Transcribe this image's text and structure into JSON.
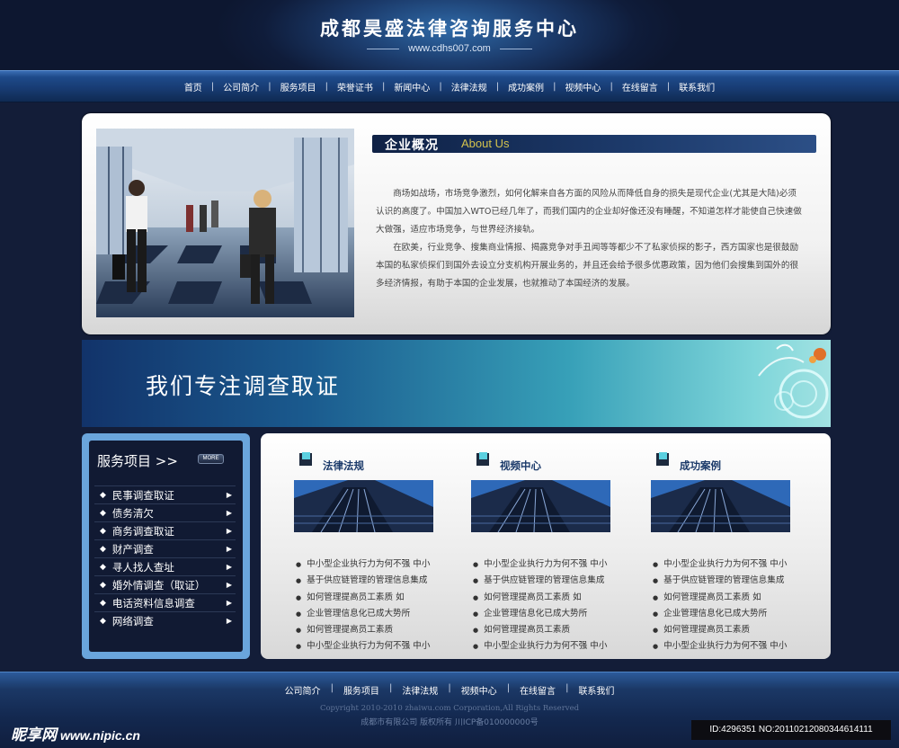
{
  "header": {
    "title": "成都昊盛法律咨询服务中心",
    "url": "www.cdhs007.com"
  },
  "nav": {
    "items": [
      "首页",
      "公司简介",
      "服务项目",
      "荣誉证书",
      "新闻中心",
      "法律法规",
      "成功案例",
      "视频中心",
      "在线留言",
      "联系我们"
    ]
  },
  "about": {
    "heading_cn": "企业概况",
    "heading_en": "About Us",
    "paragraphs": [
      "商场如战场，市场竞争激烈，如何化解来自各方面的风险从而降低自身的损失是现代企业(尤其是大陆)必须认识的高度了。中国加入WTO已经几年了，而我们国内的企业却好像还没有睡醒，不知道怎样才能使自己快速做大做强，适应市场竞争，与世界经济接轨。",
      "在欧美，行业竞争、搜集商业情报、揭露竞争对手丑闻等等都少不了私家侦探的影子，西方国家也是很鼓励本国的私家侦探们到国外去设立分支机构开展业务的，并且还会给予很多优惠政策，因为他们会搜集到国外的很多经济情报，有助于本国的企业发展，也就推动了本国经济的发展。"
    ]
  },
  "banner": {
    "text": "我们专注调查取证"
  },
  "services": {
    "title": "服务项目 >>",
    "more": "MORE",
    "items": [
      "民事调查取证",
      "债务清欠",
      "商务调查取证",
      "财产调查",
      "寻人找人查址",
      "婚外情调查（取证）",
      "电话资料信息调查",
      "网络调查"
    ]
  },
  "categories": [
    {
      "title": "法律法规",
      "items": [
        "中小型企业执行力为何不强 中小",
        "基于供应链管理的管理信息集成",
        "如何管理提高员工素质 如",
        "企业管理信息化已成大势所",
        "如何管理提高员工素质",
        "中小型企业执行力为何不强 中小"
      ]
    },
    {
      "title": "视频中心",
      "items": [
        "中小型企业执行力为何不强 中小",
        "基于供应链管理的管理信息集成",
        "如何管理提高员工素质 如",
        "企业管理信息化已成大势所",
        "如何管理提高员工素质",
        "中小型企业执行力为何不强 中小"
      ]
    },
    {
      "title": "成功案例",
      "items": [
        "中小型企业执行力为何不强 中小",
        "基于供应链管理的管理信息集成",
        "如何管理提高员工素质 如",
        "企业管理信息化已成大势所",
        "如何管理提高员工素质 ",
        "中小型企业执行力为何不强 中小"
      ]
    }
  ],
  "footer": {
    "links": [
      "公司简介",
      "服务项目",
      "法律法规",
      "视频中心",
      "在线留言",
      "联系我们"
    ],
    "copyright": "Copyright 2010-2010 zhaiwu.com Corporation,All Rights Reserved",
    "company": "成都市有限公司 版权所有   川ICP备010000000号"
  },
  "watermark": {
    "left_cn": "昵享网",
    "left_url": "www.nipic.cn",
    "right": "ID:4296351 NO:20110212080344614111"
  },
  "colors": {
    "background": "#131d38",
    "nav": "#1e4a8a",
    "accent_gold": "#d3c24d",
    "sidebar_frame": "#6aa5dc"
  }
}
